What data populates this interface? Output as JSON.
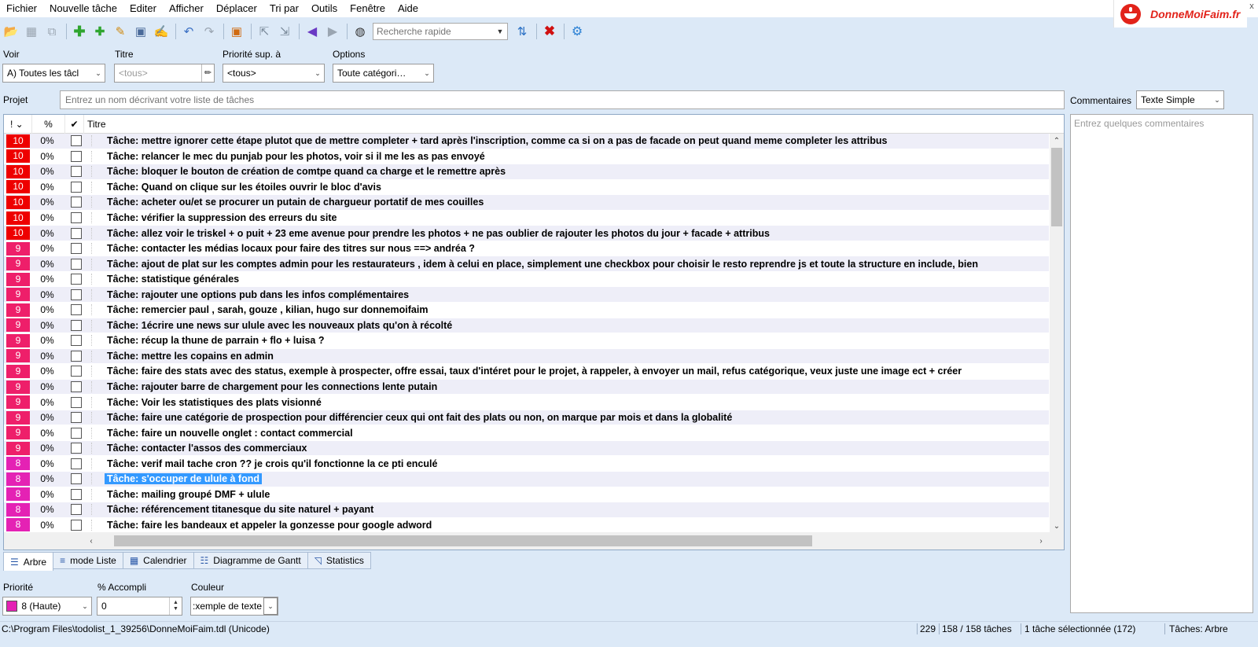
{
  "menu": [
    "Fichier",
    "Nouvelle tâche",
    "Editer",
    "Afficher",
    "Déplacer",
    "Tri par",
    "Outils",
    "Fenêtre",
    "Aide"
  ],
  "brand": "DonneMoiFaim.fr",
  "close_glyph": "x",
  "quick_search_placeholder": "Recherche rapide",
  "filters": {
    "voir_label": "Voir",
    "voir_value": "A)  Toutes les tâcl",
    "titre_label": "Titre",
    "titre_placeholder": "<tous>",
    "priorite_label": "Priorité sup. à",
    "priorite_value": "<tous>",
    "options_label": "Options",
    "options_value": "Toute catégori…"
  },
  "project": {
    "label": "Projet",
    "placeholder": "Entrez un nom décrivant votre liste de tâches"
  },
  "comments": {
    "label": "Commentaires",
    "format": "Texte Simple",
    "placeholder": "Entrez quelques commentaires"
  },
  "columns": {
    "priority": "! ⌄",
    "percent": "%",
    "done": "✔",
    "title": "Titre"
  },
  "colors": {
    "p10": "#ee0000",
    "p9": "#ee1f6a",
    "p8": "#e422b4",
    "selected": "#3399ff"
  },
  "tasks": [
    {
      "priority": "10",
      "percent": "0%",
      "title": "Tâche: mettre ignorer cette étape plutot que de mettre completer + tard après l'inscription, comme ca si on a pas de facade on peut quand meme completer les attribus"
    },
    {
      "priority": "10",
      "percent": "0%",
      "title": "Tâche: relancer le mec du punjab pour les photos, voir si il me les as pas envoyé"
    },
    {
      "priority": "10",
      "percent": "0%",
      "title": "Tâche: bloquer le bouton de création de comtpe quand ca charge et le remettre après"
    },
    {
      "priority": "10",
      "percent": "0%",
      "title": "Tâche: Quand on clique sur les étoiles ouvrir le bloc d'avis"
    },
    {
      "priority": "10",
      "percent": "0%",
      "title": "Tâche: acheter ou/et se procurer un putain de chargueur portatif de mes couilles"
    },
    {
      "priority": "10",
      "percent": "0%",
      "title": "Tâche: vérifier la suppression des erreurs du site"
    },
    {
      "priority": "10",
      "percent": "0%",
      "title": "Tâche: allez voir le triskel + o puit + 23 eme avenue pour prendre les photos + ne pas oublier de rajouter les photos du jour +  facade + attribus"
    },
    {
      "priority": "9",
      "percent": "0%",
      "title": "Tâche: contacter les médias locaux pour faire des titres sur nous ==> andréa ?"
    },
    {
      "priority": "9",
      "percent": "0%",
      "title": "Tâche: ajout de plat sur les comptes admin pour les restaurateurs , idem à celui en place, simplement une checkbox pour choisir le resto reprendre js et toute la structure en include, bien"
    },
    {
      "priority": "9",
      "percent": "0%",
      "title": "Tâche: statistique générales"
    },
    {
      "priority": "9",
      "percent": "0%",
      "title": "Tâche: rajouter une options pub dans les infos complémentaires"
    },
    {
      "priority": "9",
      "percent": "0%",
      "title": "Tâche: remercier paul , sarah, gouze , kilian, hugo sur donnemoifaim"
    },
    {
      "priority": "9",
      "percent": "0%",
      "title": "Tâche: 1écrire une news sur ulule avec les nouveaux plats qu'on à récolté"
    },
    {
      "priority": "9",
      "percent": "0%",
      "title": "Tâche: récup la thune de parrain + flo + luisa ?"
    },
    {
      "priority": "9",
      "percent": "0%",
      "title": "Tâche: mettre les copains en admin"
    },
    {
      "priority": "9",
      "percent": "0%",
      "title": "Tâche: faire des stats avec des status, exemple à prospecter, offre essai, taux d'intéret pour le projet, à rappeler, à envoyer un mail, refus catégorique, veux juste une image ect + créer"
    },
    {
      "priority": "9",
      "percent": "0%",
      "title": "Tâche: rajouter barre de chargement pour les connections lente putain"
    },
    {
      "priority": "9",
      "percent": "0%",
      "title": "Tâche: Voir les statistiques des plats visionné"
    },
    {
      "priority": "9",
      "percent": "0%",
      "title": "Tâche: faire une catégorie de prospection pour différencier ceux qui ont fait des plats ou non, on marque par mois et dans la globalité"
    },
    {
      "priority": "9",
      "percent": "0%",
      "title": "Tâche: faire un nouvelle onglet : contact commercial"
    },
    {
      "priority": "9",
      "percent": "0%",
      "title": "Tâche: contacter l'assos des commerciaux"
    },
    {
      "priority": "8",
      "percent": "0%",
      "title": "Tâche: verif mail tache cron ?? je crois qu'il fonctionne la ce pti enculé"
    },
    {
      "priority": "8",
      "percent": "0%",
      "title": "Tâche: s'occuper de ulule à fond",
      "selected": true
    },
    {
      "priority": "8",
      "percent": "0%",
      "title": "Tâche: mailing groupé DMF + ulule"
    },
    {
      "priority": "8",
      "percent": "0%",
      "title": "Tâche: référencement titanesque du site naturel + payant"
    },
    {
      "priority": "8",
      "percent": "0%",
      "title": "Tâche: faire les bandeaux et appeler la gonzesse pour google adword"
    }
  ],
  "tabs": [
    {
      "label": "Arbre",
      "icon": "tree-icon",
      "active": true
    },
    {
      "label": "mode Liste",
      "icon": "list-icon"
    },
    {
      "label": "Calendrier",
      "icon": "calendar-icon"
    },
    {
      "label": "Diagramme de Gantt",
      "icon": "gantt-icon"
    },
    {
      "label": "Statistics",
      "icon": "statistics-icon"
    }
  ],
  "attributes": {
    "priority_label": "Priorité",
    "priority_value": "8 (Haute)",
    "percent_label": "% Accompli",
    "percent_value": "0",
    "color_label": "Couleur",
    "color_value": ":xemple de texte"
  },
  "status": {
    "path": "C:\\Program Files\\todolist_1_39256\\DonneMoiFaim.tdl (Unicode)",
    "count": "229",
    "tasks": "158 / 158 tâches",
    "selection": "1 tâche sélectionnée (172)",
    "view": "Tâches: Arbre"
  }
}
